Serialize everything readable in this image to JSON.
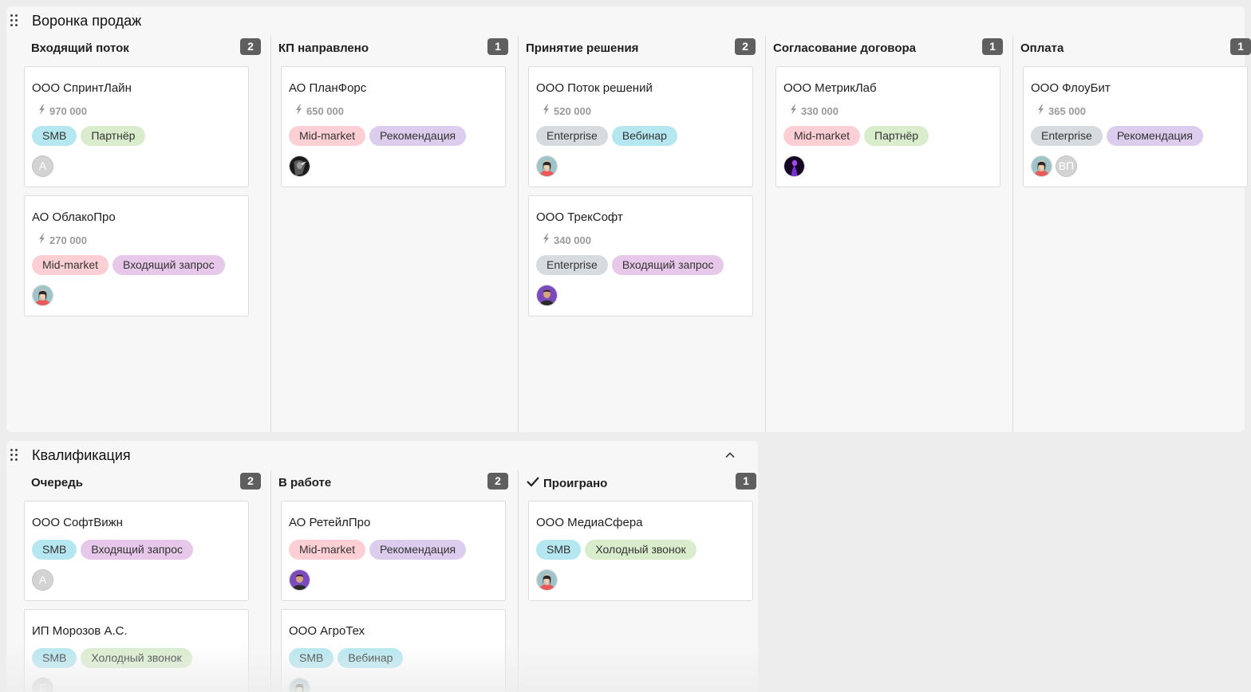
{
  "colors": {
    "tag_smb": "#b5e7f0",
    "tag_partner": "#d9edcd",
    "tag_mid_market": "#fccfd4",
    "tag_referral": "#dccdee",
    "tag_inbound": "#e8c8ea",
    "tag_enterprise": "#d6dbe0",
    "tag_webinar": "#b5e7f0",
    "tag_cold_call": "#d9edcd",
    "badge_bg": "#5f5f5f"
  },
  "boards": [
    {
      "title": "Воронка продаж",
      "collapsible": false,
      "columns": [
        {
          "title": "Входящий поток",
          "count": "2",
          "checked": false,
          "cards": [
            {
              "title": "ООО СпринтЛайн",
              "amount": "970 000",
              "tags": [
                {
                  "label": "SMB",
                  "color": "#b5e7f0"
                },
                {
                  "label": "Партнёр",
                  "color": "#d9edcd"
                }
              ],
              "avatars": [
                {
                  "type": "initials",
                  "text": "А"
                }
              ]
            },
            {
              "title": "АО ОблакоПро",
              "amount": "270 000",
              "tags": [
                {
                  "label": "Mid-market",
                  "color": "#fccfd4"
                },
                {
                  "label": "Входящий запрос",
                  "color": "#e8c8ea"
                }
              ],
              "avatars": [
                {
                  "type": "photo",
                  "icon": "woman-avatar-icon"
                }
              ]
            }
          ]
        },
        {
          "title": "КП направлено",
          "count": "1",
          "checked": false,
          "cards": [
            {
              "title": "АО ПланФорс",
              "amount": "650 000",
              "tags": [
                {
                  "label": "Mid-market",
                  "color": "#fccfd4"
                },
                {
                  "label": "Рекомендация",
                  "color": "#dccdee"
                }
              ],
              "avatars": [
                {
                  "type": "photo",
                  "icon": "dark-portrait-avatar-icon"
                }
              ]
            }
          ]
        },
        {
          "title": "Принятие решения",
          "count": "2",
          "checked": false,
          "cards": [
            {
              "title": "ООО Поток решений",
              "amount": "520 000",
              "tags": [
                {
                  "label": "Enterprise",
                  "color": "#d6dbe0"
                },
                {
                  "label": "Вебинар",
                  "color": "#b5e7f0"
                }
              ],
              "avatars": [
                {
                  "type": "photo",
                  "icon": "woman-avatar-icon"
                }
              ]
            },
            {
              "title": "ООО ТрекСофт",
              "amount": "340 000",
              "tags": [
                {
                  "label": "Enterprise",
                  "color": "#d6dbe0"
                },
                {
                  "label": "Входящий запрос",
                  "color": "#e8c8ea"
                }
              ],
              "avatars": [
                {
                  "type": "photo",
                  "icon": "man-purple-avatar-icon"
                }
              ]
            }
          ]
        },
        {
          "title": "Согласование договора",
          "count": "1",
          "checked": false,
          "cards": [
            {
              "title": "ООО МетрикЛаб",
              "amount": "330 000",
              "tags": [
                {
                  "label": "Mid-market",
                  "color": "#fccfd4"
                },
                {
                  "label": "Партнёр",
                  "color": "#d9edcd"
                }
              ],
              "avatars": [
                {
                  "type": "photo",
                  "icon": "purple-silhouette-avatar-icon"
                }
              ]
            }
          ]
        },
        {
          "title": "Оплата",
          "count": "1",
          "checked": false,
          "cards": [
            {
              "title": "ООО ФлоуБит",
              "amount": "365 000",
              "tags": [
                {
                  "label": "Enterprise",
                  "color": "#d6dbe0"
                },
                {
                  "label": "Рекомендация",
                  "color": "#dccdee"
                }
              ],
              "avatars": [
                {
                  "type": "photo",
                  "icon": "woman-avatar-icon"
                },
                {
                  "type": "initials",
                  "text": "ВП"
                }
              ]
            }
          ]
        }
      ]
    },
    {
      "title": "Квалификация",
      "collapsible": true,
      "columns": [
        {
          "title": "Очередь",
          "count": "2",
          "checked": false,
          "cards": [
            {
              "title": "ООО СофтВижн",
              "amount": null,
              "tags": [
                {
                  "label": "SMB",
                  "color": "#b5e7f0"
                },
                {
                  "label": "Входящий запрос",
                  "color": "#e8c8ea"
                }
              ],
              "avatars": [
                {
                  "type": "initials",
                  "text": "А"
                }
              ]
            },
            {
              "title": "ИП Морозов А.С.",
              "amount": null,
              "tags": [
                {
                  "label": "SMB",
                  "color": "#b5e7f0"
                },
                {
                  "label": "Холодный звонок",
                  "color": "#d9edcd"
                }
              ],
              "avatars": [
                {
                  "type": "initials",
                  "text": "Е"
                }
              ]
            }
          ]
        },
        {
          "title": "В работе",
          "count": "2",
          "checked": false,
          "cards": [
            {
              "title": "АО РетейлПро",
              "amount": null,
              "tags": [
                {
                  "label": "Mid-market",
                  "color": "#fccfd4"
                },
                {
                  "label": "Рекомендация",
                  "color": "#dccdee"
                }
              ],
              "avatars": [
                {
                  "type": "photo",
                  "icon": "man-purple-avatar-icon"
                }
              ]
            },
            {
              "title": "ООО АгроТех",
              "amount": null,
              "tags": [
                {
                  "label": "SMB",
                  "color": "#b5e7f0"
                },
                {
                  "label": "Вебинар",
                  "color": "#b5e7f0"
                }
              ],
              "avatars": [
                {
                  "type": "photo",
                  "icon": "woman-avatar-icon"
                }
              ]
            }
          ]
        },
        {
          "title": "Проиграно",
          "count": "1",
          "checked": true,
          "cards": [
            {
              "title": "ООО МедиаСфера",
              "amount": null,
              "tags": [
                {
                  "label": "SMB",
                  "color": "#b5e7f0"
                },
                {
                  "label": "Холодный звонок",
                  "color": "#d9edcd"
                }
              ],
              "avatars": [
                {
                  "type": "photo",
                  "icon": "woman-avatar-icon"
                }
              ]
            }
          ]
        }
      ]
    }
  ]
}
